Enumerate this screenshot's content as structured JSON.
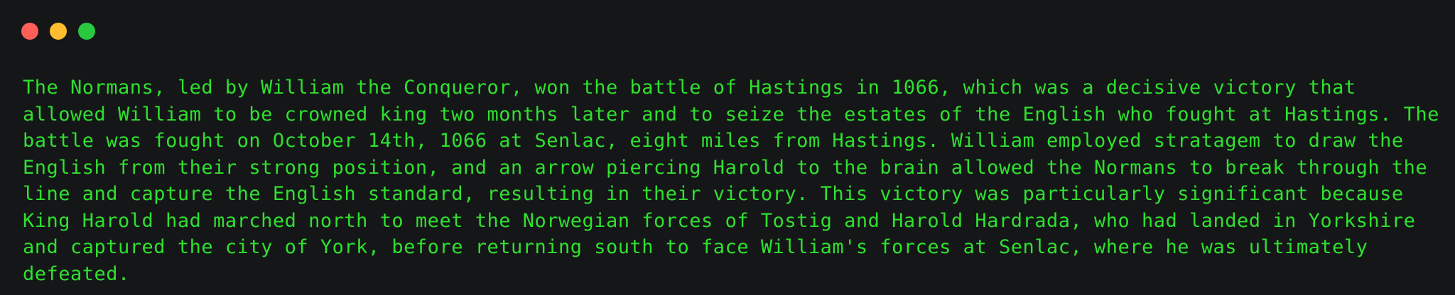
{
  "window": {
    "controls": [
      "close-icon",
      "minimize-icon",
      "maximize-icon"
    ],
    "colors": {
      "background": "#151618",
      "text": "#2fe02f",
      "close": "#ff5f57",
      "minimize": "#febc2e",
      "maximize": "#28c840"
    }
  },
  "text": {
    "lines": [
      "The Normans, led by William the Conqueror, won the battle of Hastings in 1066, which was a decisive victory that",
      "allowed William to be crowned king two months later and to seize the estates of the English who fought at Hastings. The",
      "battle was fought on October 14th, 1066 at Senlac, eight miles from Hastings. William employed stratagem to draw the",
      "English from their strong position, and an arrow piercing Harold to the brain allowed the Normans to break through the",
      "line and capture the English standard, resulting in their victory. This victory was particularly significant because",
      "King Harold had marched north to meet the Norwegian forces of Tostig and Harold Hardrada, who had landed in Yorkshire",
      "and captured the city of York, before returning south to face William's forces at Senlac, where he was ultimately",
      "defeated."
    ]
  }
}
